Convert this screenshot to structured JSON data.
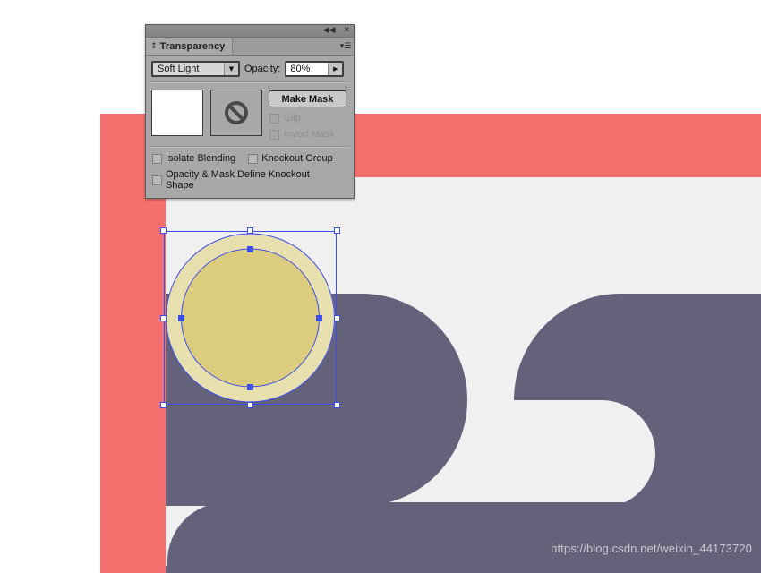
{
  "panel": {
    "title": "Transparency",
    "titlebar": {
      "collapse_icon": "collapse-double-left-icon",
      "collapse_glyph": "◀◀",
      "close_icon": "close-icon",
      "close_glyph": "✕",
      "menu_icon": "panel-menu-icon",
      "menu_glyph": "▾☰"
    },
    "tab_grip_glyph": "↕",
    "blend_mode": {
      "label": "Soft Light",
      "arrow_glyph": "▼"
    },
    "opacity": {
      "label": "Opacity:",
      "value": "80%",
      "arrow_glyph": "▶"
    },
    "thumbnails": {
      "artwork_name": "artwork-thumbnail",
      "mask_name": "mask-thumbnail",
      "mask_icon": "no-mask-icon"
    },
    "make_mask_label": "Make Mask",
    "clip": {
      "label": "Clip",
      "checked": false,
      "enabled": false
    },
    "invert_mask": {
      "label": "Invert Mask",
      "checked": false,
      "enabled": false
    },
    "isolate_blending": {
      "label": "Isolate Blending",
      "checked": false,
      "enabled": true
    },
    "knockout_group": {
      "label": "Knockout Group",
      "checked": false,
      "enabled": true
    },
    "opacity_mask_knockout": {
      "label": "Opacity & Mask Define Knockout Shape",
      "checked": false,
      "enabled": true
    }
  },
  "canvas": {
    "colors": {
      "background": "#f0f0f0",
      "red": "#f4706e",
      "gray": "#64627a",
      "circle_outer": "#e8dfae",
      "circle_inner": "#dccc7e",
      "selection": "#3b4ee8"
    },
    "shapes": {
      "red_band_name": "red-banner-shape",
      "red_strip_name": "red-side-strip-shape",
      "circle_outer_name": "outer-circle-shape",
      "circle_inner_name": "inner-circle-shape",
      "pill_left_name": "gray-pill-left-shape",
      "pill_right_name": "gray-pill-right-shape",
      "bar_bottom_name": "gray-bottom-bar-shape"
    }
  },
  "watermark": {
    "text": "https://blog.csdn.net/weixin_44173720"
  }
}
